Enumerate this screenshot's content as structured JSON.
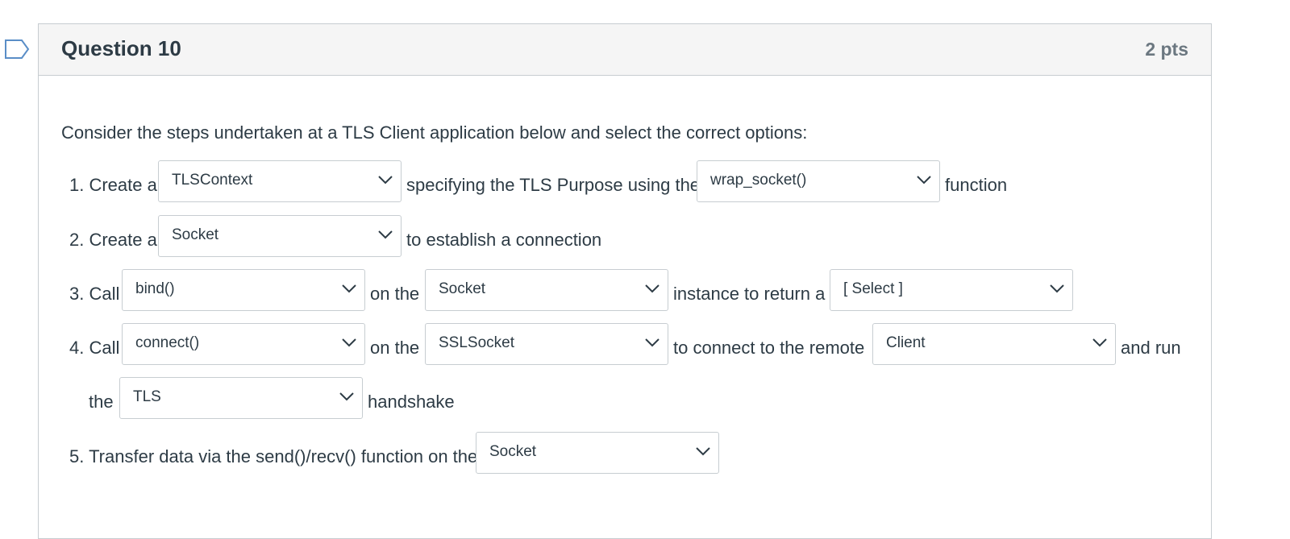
{
  "question": {
    "title": "Question 10",
    "points": "2 pts",
    "intro": "Consider the steps undertaken at a TLS Client application below and select the correct options:"
  },
  "steps": {
    "s1": {
      "prefix": "1. Create a",
      "dd1": "TLSContext",
      "mid": "specifying the TLS Purpose using the",
      "dd2": "wrap_socket()",
      "suffix": "function"
    },
    "s2": {
      "prefix": "2. Create a",
      "dd1": "Socket",
      "suffix": "to establish a connection"
    },
    "s3": {
      "prefix": "3. Call",
      "dd1": "bind()",
      "mid": "on the",
      "dd2": "Socket",
      "mid2": "instance to return a",
      "dd3": "[ Select ]"
    },
    "s4": {
      "prefix": "4. Call",
      "dd1": "connect()",
      "mid": "on the",
      "dd2": "SSLSocket",
      "mid2": "to connect to the remote",
      "dd3": "Client",
      "suffix": "and run",
      "cont_prefix": "the",
      "dd4": "TLS",
      "cont_suffix": "handshake"
    },
    "s5": {
      "prefix": "5. Transfer data via the send()/recv() function on the",
      "dd1": "Socket"
    }
  },
  "colors": {
    "header_bg": "#f5f5f5",
    "border": "#c7cdd1",
    "text": "#2d3b45",
    "points": "#6b7780",
    "flag": "#5a8ec7"
  },
  "icons": {
    "flag": "bookmark-flag-icon",
    "dropdown": "chevron-down-icon"
  }
}
